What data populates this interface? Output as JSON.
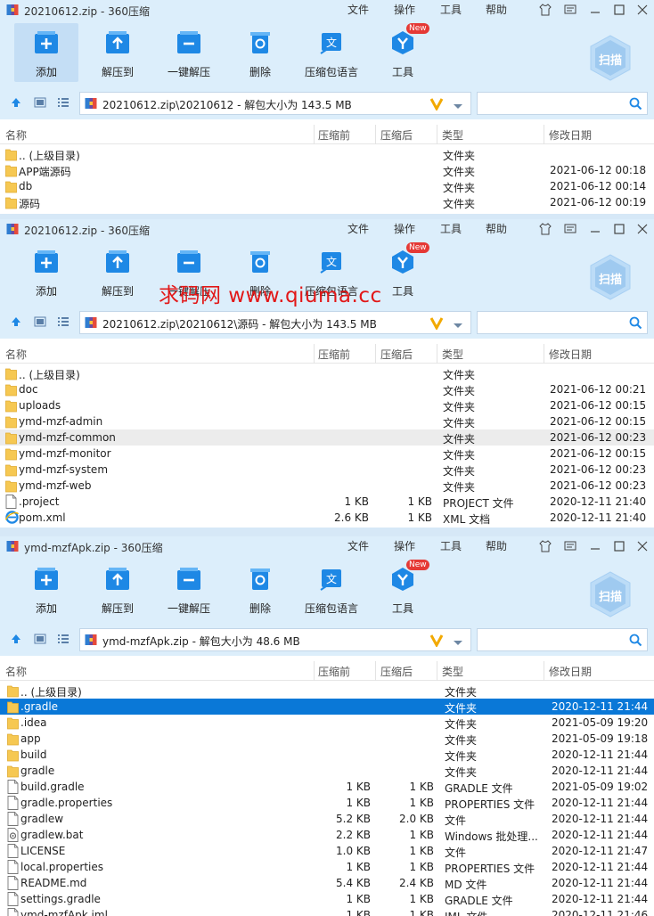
{
  "menu": {
    "file": "文件",
    "ops": "操作",
    "tools": "工具",
    "help": "帮助"
  },
  "toolbar": {
    "add": "添加",
    "extract_to": "解压到",
    "one_click": "一键解压",
    "delete": "删除",
    "lang_pack": "压缩包语言",
    "tools": "工具",
    "new_badge": "New",
    "scan": "扫描"
  },
  "columns": {
    "name": "名称",
    "packed": "压缩前",
    "unpacked": "压缩后",
    "type": "类型",
    "date": "修改日期"
  },
  "watermark": "求码网 www.qiuma.cc",
  "windows": [
    {
      "title": "20210612.zip - 360压缩",
      "address": "20210612.zip\\20210612 - 解包大小为 143.5 MB",
      "rows": [
        {
          "name": ".. (上级目录)",
          "packed": "",
          "unpacked": "",
          "type": "文件夹",
          "date": "",
          "icon": "folder"
        },
        {
          "name": "APP端源码",
          "packed": "",
          "unpacked": "",
          "type": "文件夹",
          "date": "2021-06-12 00:18",
          "icon": "folder"
        },
        {
          "name": "db",
          "packed": "",
          "unpacked": "",
          "type": "文件夹",
          "date": "2021-06-12 00:14",
          "icon": "folder"
        },
        {
          "name": "源码",
          "packed": "",
          "unpacked": "",
          "type": "文件夹",
          "date": "2021-06-12 00:19",
          "icon": "folder"
        }
      ]
    },
    {
      "title": "20210612.zip - 360压缩",
      "address": "20210612.zip\\20210612\\源码 - 解包大小为 143.5 MB",
      "rows": [
        {
          "name": ".. (上级目录)",
          "packed": "",
          "unpacked": "",
          "type": "文件夹",
          "date": "",
          "icon": "folder"
        },
        {
          "name": "doc",
          "packed": "",
          "unpacked": "",
          "type": "文件夹",
          "date": "2021-06-12 00:21",
          "icon": "folder"
        },
        {
          "name": "uploads",
          "packed": "",
          "unpacked": "",
          "type": "文件夹",
          "date": "2021-06-12 00:15",
          "icon": "folder"
        },
        {
          "name": "ymd-mzf-admin",
          "packed": "",
          "unpacked": "",
          "type": "文件夹",
          "date": "2021-06-12 00:15",
          "icon": "folder"
        },
        {
          "name": "ymd-mzf-common",
          "packed": "",
          "unpacked": "",
          "type": "文件夹",
          "date": "2021-06-12 00:23",
          "icon": "folder"
        },
        {
          "name": "ymd-mzf-monitor",
          "packed": "",
          "unpacked": "",
          "type": "文件夹",
          "date": "2021-06-12 00:15",
          "icon": "folder"
        },
        {
          "name": "ymd-mzf-system",
          "packed": "",
          "unpacked": "",
          "type": "文件夹",
          "date": "2021-06-12 00:23",
          "icon": "folder"
        },
        {
          "name": "ymd-mzf-web",
          "packed": "",
          "unpacked": "",
          "type": "文件夹",
          "date": "2021-06-12 00:23",
          "icon": "folder"
        },
        {
          "name": ".project",
          "packed": "1 KB",
          "unpacked": "1 KB",
          "type": "PROJECT 文件",
          "date": "2020-12-11 21:40",
          "icon": "file"
        },
        {
          "name": "pom.xml",
          "packed": "2.6 KB",
          "unpacked": "1 KB",
          "type": "XML 文档",
          "date": "2020-12-11 21:40",
          "icon": "ie"
        }
      ]
    },
    {
      "title": "ymd-mzfApk.zip - 360压缩",
      "address": "ymd-mzfApk.zip - 解包大小为 48.6 MB",
      "rows": [
        {
          "name": ".. (上级目录)",
          "packed": "",
          "unpacked": "",
          "type": "文件夹",
          "date": "",
          "icon": "folder"
        },
        {
          "name": ".gradle",
          "packed": "",
          "unpacked": "",
          "type": "文件夹",
          "date": "2020-12-11 21:44",
          "icon": "folder"
        },
        {
          "name": ".idea",
          "packed": "",
          "unpacked": "",
          "type": "文件夹",
          "date": "2021-05-09 19:20",
          "icon": "folder"
        },
        {
          "name": "app",
          "packed": "",
          "unpacked": "",
          "type": "文件夹",
          "date": "2021-05-09 19:18",
          "icon": "folder"
        },
        {
          "name": "build",
          "packed": "",
          "unpacked": "",
          "type": "文件夹",
          "date": "2020-12-11 21:44",
          "icon": "folder"
        },
        {
          "name": "gradle",
          "packed": "",
          "unpacked": "",
          "type": "文件夹",
          "date": "2020-12-11 21:44",
          "icon": "folder"
        },
        {
          "name": "build.gradle",
          "packed": "1 KB",
          "unpacked": "1 KB",
          "type": "GRADLE 文件",
          "date": "2021-05-09 19:02",
          "icon": "file"
        },
        {
          "name": "gradle.properties",
          "packed": "1 KB",
          "unpacked": "1 KB",
          "type": "PROPERTIES 文件",
          "date": "2020-12-11 21:44",
          "icon": "file"
        },
        {
          "name": "gradlew",
          "packed": "5.2 KB",
          "unpacked": "2.0 KB",
          "type": "文件",
          "date": "2020-12-11 21:44",
          "icon": "file"
        },
        {
          "name": "gradlew.bat",
          "packed": "2.2 KB",
          "unpacked": "1 KB",
          "type": "Windows 批处理...",
          "date": "2020-12-11 21:44",
          "icon": "bat"
        },
        {
          "name": "LICENSE",
          "packed": "1.0 KB",
          "unpacked": "1 KB",
          "type": "文件",
          "date": "2020-12-11 21:47",
          "icon": "file"
        },
        {
          "name": "local.properties",
          "packed": "1 KB",
          "unpacked": "1 KB",
          "type": "PROPERTIES 文件",
          "date": "2020-12-11 21:44",
          "icon": "file"
        },
        {
          "name": "README.md",
          "packed": "5.4 KB",
          "unpacked": "2.4 KB",
          "type": "MD 文件",
          "date": "2020-12-11 21:44",
          "icon": "file"
        },
        {
          "name": "settings.gradle",
          "packed": "1 KB",
          "unpacked": "1 KB",
          "type": "GRADLE 文件",
          "date": "2020-12-11 21:44",
          "icon": "file"
        },
        {
          "name": "ymd-mzfApk.iml",
          "packed": "1 KB",
          "unpacked": "1 KB",
          "type": "IML 文件",
          "date": "2020-12-11 21:46",
          "icon": "file"
        }
      ]
    }
  ]
}
